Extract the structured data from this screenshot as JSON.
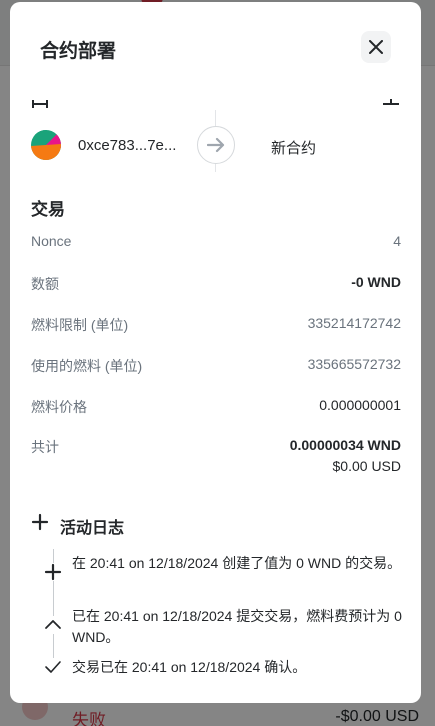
{
  "backdrop": {
    "failed_label": "失败",
    "amount": "-$0.00 USD"
  },
  "modal": {
    "title": "合约部署",
    "from_address": "0xce783...7e...",
    "to_label": "新合约"
  },
  "transaction": {
    "section_title": "交易",
    "rows": [
      {
        "label": "Nonce",
        "value": "4"
      },
      {
        "label": "数额",
        "value": "-0 WND"
      },
      {
        "label": "燃料限制 (单位)",
        "value": "335214172742"
      },
      {
        "label": "使用的燃料 (单位)",
        "value": "335665572732"
      },
      {
        "label": "燃料价格",
        "value": "0.000000001"
      },
      {
        "label": "共计",
        "value": "0.00000034 WND"
      }
    ],
    "total_usd": "$0.00 USD"
  },
  "activity": {
    "title": "活动日志",
    "entries": [
      {
        "icon": "plus-icon",
        "text": "在 20:41 on 12/18/2024 创建了值为 0 WND 的交易。"
      },
      {
        "icon": "chevron-up-icon",
        "text": "已在 20:41 on 12/18/2024 提交交易，燃料费预计为 0 WND。"
      },
      {
        "icon": "check-icon",
        "text": "交易已在 20:41 on 12/18/2024 确认。"
      }
    ]
  },
  "colors": {
    "accent_red": "#d73847",
    "text_primary": "#24272a",
    "text_muted": "#6a737d"
  }
}
